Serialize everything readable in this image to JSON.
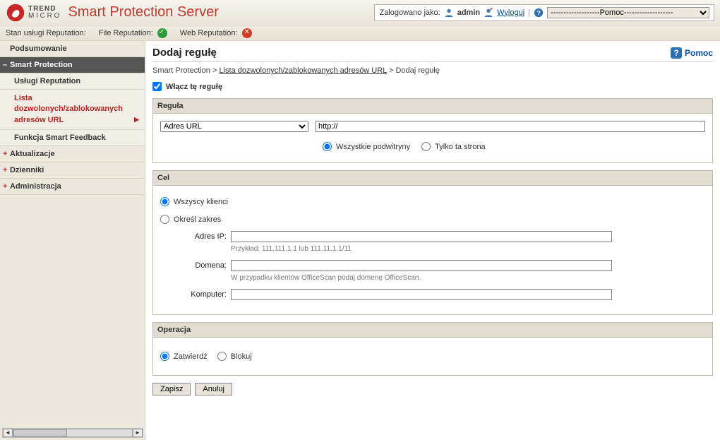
{
  "brand": {
    "trend": "TREND",
    "micro": "M I C R O",
    "product": "Smart Protection Server"
  },
  "login": {
    "logged_as_label": "Zalogowano jako:",
    "user": "admin",
    "logout": "Wyloguj",
    "help_select": "-------------------Pomoc-------------------"
  },
  "status": {
    "services_label": "Stan usługi Reputation:",
    "file_label": "File Reputation:",
    "web_label": "Web Reputation:"
  },
  "sidebar": {
    "summary": "Podsumowanie",
    "smart_protection": "Smart Protection",
    "reputation": "Usługi Reputation",
    "list": "Lista dozwolonych/zablokowanych adresów URL",
    "feedback": "Funkcja Smart Feedback",
    "updates": "Aktualizacje",
    "logs": "Dzienniki",
    "admin": "Administracja"
  },
  "page": {
    "title": "Dodaj regułę",
    "help": "Pomoc",
    "crumb_root": "Smart Protection",
    "crumb_list": "Lista dozwolonych/zablokowanych adresów URL",
    "crumb_current": "Dodaj regułę",
    "enable_label": "Włącz tę regułę"
  },
  "regula": {
    "header": "Reguła",
    "select_value": "Adres URL",
    "url_value": "http://",
    "opt_all": "Wszystkie podwitryny",
    "opt_page": "Tylko ta strona"
  },
  "cel": {
    "header": "Cel",
    "opt_all": "Wszyscy klienci",
    "opt_range": "Określ zakres",
    "ip_label": "Adres IP:",
    "ip_hint": "Przykład: 111.111.1.1 lub 111.11.1.1/11",
    "domain_label": "Domena:",
    "domain_hint": "W przypadku klientów OfficeScan podaj domenę OfficeScan.",
    "computer_label": "Komputer:"
  },
  "op": {
    "header": "Operacja",
    "approve": "Zatwierdź",
    "block": "Blokuj"
  },
  "buttons": {
    "save": "Zapisz",
    "cancel": "Anuluj"
  }
}
